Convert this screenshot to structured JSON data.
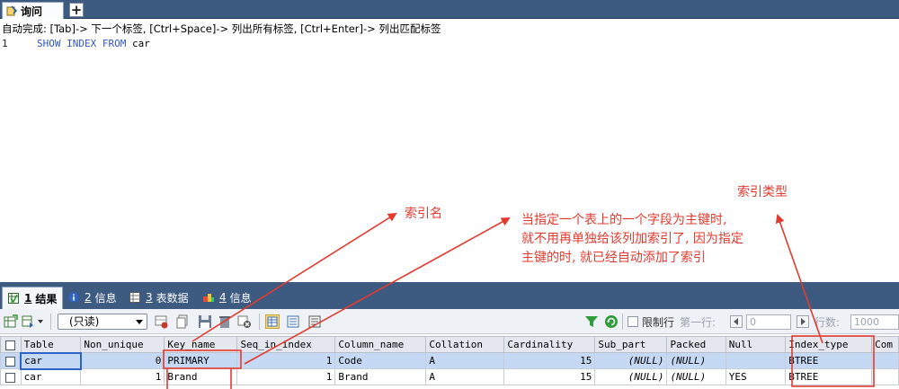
{
  "query_tab": {
    "label": "询问"
  },
  "add_tab_label": "+",
  "autocomplete_hint": "自动完成: [Tab]-> 下一个标签, [Ctrl+Space]-> 列出所有标签, [Ctrl+Enter]-> 列出匹配标签",
  "editor": {
    "line_number": "1",
    "keywords": "SHOW INDEX FROM",
    "rest": " car"
  },
  "annotations": {
    "index_name": "索引名",
    "primary_key_note": [
      "当指定一个表上的一个字段为主键时,",
      "就不用再单独给该列加索引了, 因为指定",
      "主键的时, 就已经自动添加了索引"
    ],
    "index_type": "索引类型"
  },
  "result_tabs": [
    {
      "num": "1",
      "label": "结果",
      "active": true
    },
    {
      "num": "2",
      "label": "信息",
      "active": false
    },
    {
      "num": "3",
      "label": "表数据",
      "active": false
    },
    {
      "num": "4",
      "label": "信息",
      "active": false
    }
  ],
  "toolbar": {
    "mode": "(只读)",
    "limit_label": "限制行",
    "first_row_label": "第一行:",
    "first_row_value": "0",
    "rows_label": "行数:",
    "rows_value": "1000"
  },
  "grid": {
    "columns": [
      "Table",
      "Non_unique",
      "Key_name",
      "Seq_in_index",
      "Column_name",
      "Collation",
      "Cardinality",
      "Sub_part",
      "Packed",
      "Null",
      "Index_type",
      "Com"
    ],
    "rows": [
      [
        "car",
        "0",
        "PRIMARY",
        "1",
        "Code",
        "A",
        "15",
        "(NULL)",
        "(NULL)",
        "",
        "BTREE",
        ""
      ],
      [
        "car",
        "1",
        "Brand",
        "1",
        "Brand",
        "A",
        "15",
        "(NULL)",
        "(NULL)",
        "YES",
        "BTREE",
        ""
      ]
    ]
  },
  "colors": {
    "tab_bar": "#3d5a80",
    "annotation_red": "#e23a2f",
    "keyword_blue": "#3355cc",
    "selected_row": "#c6d9f4"
  }
}
